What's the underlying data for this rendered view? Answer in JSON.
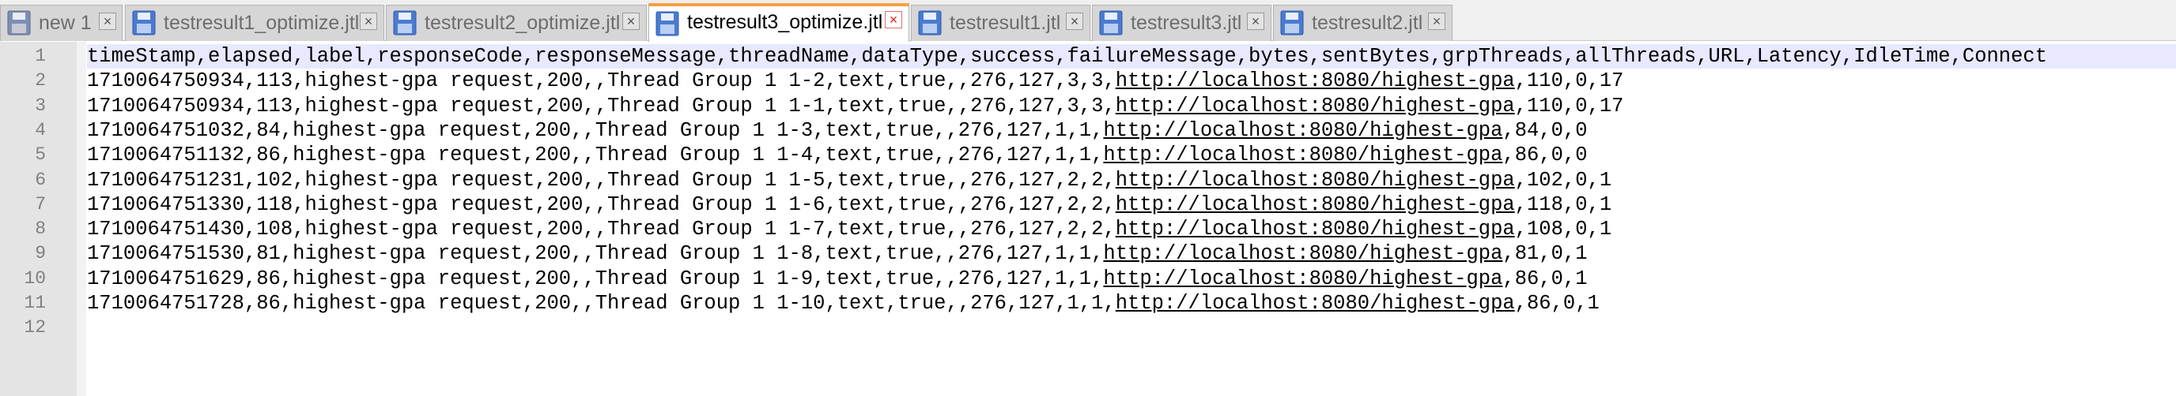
{
  "tabs": [
    {
      "label": "new 1",
      "active": false,
      "icon": "floppy-disk-icon"
    },
    {
      "label": "testresult1_optimize.jtl",
      "active": false,
      "icon": "floppy-disk-icon"
    },
    {
      "label": "testresult2_optimize.jtl",
      "active": false,
      "icon": "floppy-disk-icon"
    },
    {
      "label": "testresult3_optimize.jtl",
      "active": true,
      "icon": "floppy-disk-icon"
    },
    {
      "label": "testresult1.jtl",
      "active": false,
      "icon": "floppy-disk-icon"
    },
    {
      "label": "testresult3.jtl",
      "active": false,
      "icon": "floppy-disk-icon"
    },
    {
      "label": "testresult2.jtl",
      "active": false,
      "icon": "floppy-disk-icon"
    }
  ],
  "close_glyph": "×",
  "editor": {
    "line_numbers": [
      "1",
      "2",
      "3",
      "4",
      "5",
      "6",
      "7",
      "8",
      "9",
      "10",
      "11",
      "12"
    ],
    "lines": [
      {
        "pre": "timeStamp,elapsed,label,responseCode,responseMessage,threadName,dataType,success,failureMessage,bytes,sentBytes,grpThreads,allThreads,URL,Latency,IdleTime,Connect",
        "url": "",
        "post": ""
      },
      {
        "pre": "1710064750934,113,highest-gpa request,200,,Thread Group 1 1-2,text,true,,276,127,3,3,",
        "url": "http://localhost:8080/highest-gpa",
        "post": ",110,0,17"
      },
      {
        "pre": "1710064750934,113,highest-gpa request,200,,Thread Group 1 1-1,text,true,,276,127,3,3,",
        "url": "http://localhost:8080/highest-gpa",
        "post": ",110,0,17"
      },
      {
        "pre": "1710064751032,84,highest-gpa request,200,,Thread Group 1 1-3,text,true,,276,127,1,1,",
        "url": "http://localhost:8080/highest-gpa",
        "post": ",84,0,0"
      },
      {
        "pre": "1710064751132,86,highest-gpa request,200,,Thread Group 1 1-4,text,true,,276,127,1,1,",
        "url": "http://localhost:8080/highest-gpa",
        "post": ",86,0,0"
      },
      {
        "pre": "1710064751231,102,highest-gpa request,200,,Thread Group 1 1-5,text,true,,276,127,2,2,",
        "url": "http://localhost:8080/highest-gpa",
        "post": ",102,0,1"
      },
      {
        "pre": "1710064751330,118,highest-gpa request,200,,Thread Group 1 1-6,text,true,,276,127,2,2,",
        "url": "http://localhost:8080/highest-gpa",
        "post": ",118,0,1"
      },
      {
        "pre": "1710064751430,108,highest-gpa request,200,,Thread Group 1 1-7,text,true,,276,127,2,2,",
        "url": "http://localhost:8080/highest-gpa",
        "post": ",108,0,1"
      },
      {
        "pre": "1710064751530,81,highest-gpa request,200,,Thread Group 1 1-8,text,true,,276,127,1,1,",
        "url": "http://localhost:8080/highest-gpa",
        "post": ",81,0,1"
      },
      {
        "pre": "1710064751629,86,highest-gpa request,200,,Thread Group 1 1-9,text,true,,276,127,1,1,",
        "url": "http://localhost:8080/highest-gpa",
        "post": ",86,0,1"
      },
      {
        "pre": "1710064751728,86,highest-gpa request,200,,Thread Group 1 1-10,text,true,,276,127,1,1,",
        "url": "http://localhost:8080/highest-gpa",
        "post": ",86,0,1"
      },
      {
        "pre": "",
        "url": "",
        "post": ""
      }
    ]
  }
}
